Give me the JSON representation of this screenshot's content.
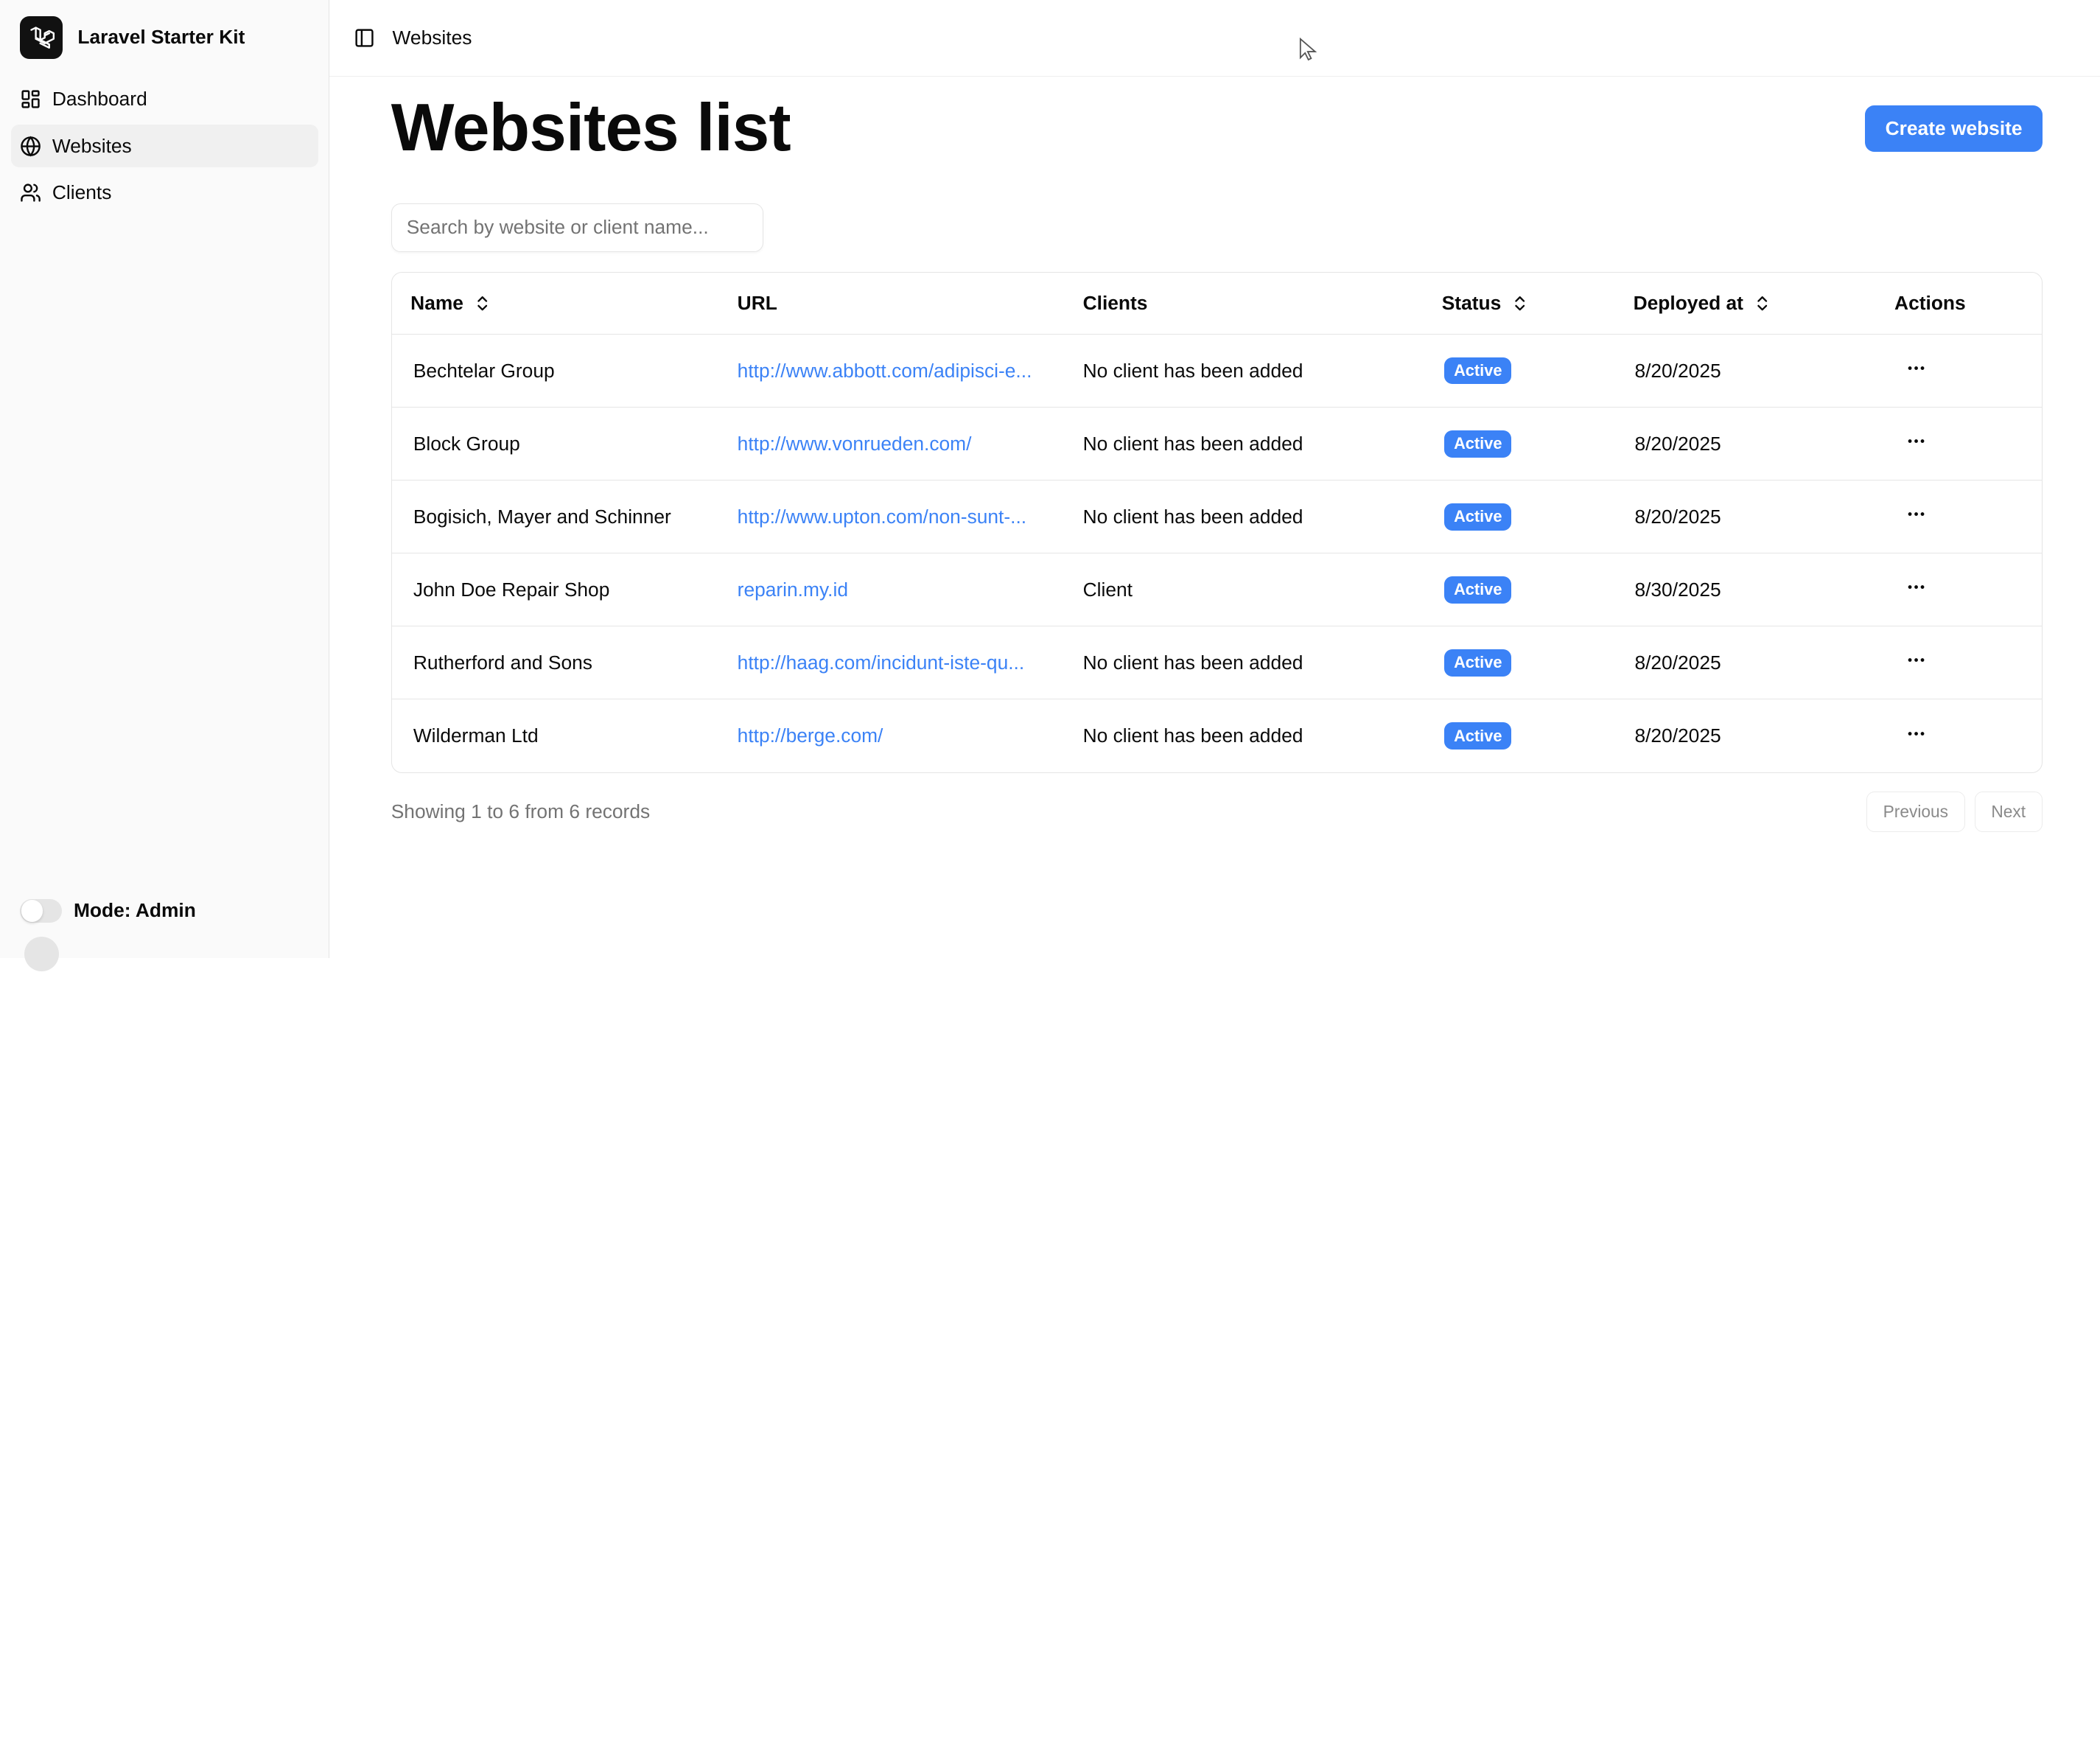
{
  "app": {
    "name": "Laravel Starter Kit"
  },
  "sidebar": {
    "items": [
      {
        "label": "Dashboard",
        "icon": "grid-icon",
        "active": false
      },
      {
        "label": "Websites",
        "icon": "globe-icon",
        "active": true
      },
      {
        "label": "Clients",
        "icon": "users-icon",
        "active": false
      }
    ],
    "mode_label": "Mode: Admin"
  },
  "topbar": {
    "breadcrumb": "Websites"
  },
  "page": {
    "title": "Websites list",
    "create_button": "Create website",
    "search_placeholder": "Search by website or client name..."
  },
  "table": {
    "columns": [
      "Name",
      "URL",
      "Clients",
      "Status",
      "Deployed at",
      "Actions"
    ],
    "rows": [
      {
        "name": "Bechtelar Group",
        "url": "http://www.abbott.com/adipisci-e...",
        "clients": "No client has been added",
        "status": "Active",
        "deployed": "8/20/2025"
      },
      {
        "name": "Block Group",
        "url": "http://www.vonrueden.com/",
        "clients": "No client has been added",
        "status": "Active",
        "deployed": "8/20/2025"
      },
      {
        "name": "Bogisich, Mayer and Schinner",
        "url": "http://www.upton.com/non-sunt-...",
        "clients": "No client has been added",
        "status": "Active",
        "deployed": "8/20/2025"
      },
      {
        "name": "John Doe Repair Shop",
        "url": "reparin.my.id",
        "clients": "Client",
        "status": "Active",
        "deployed": "8/30/2025"
      },
      {
        "name": "Rutherford and Sons",
        "url": "http://haag.com/incidunt-iste-qu...",
        "clients": "No client has been added",
        "status": "Active",
        "deployed": "8/20/2025"
      },
      {
        "name": "Wilderman Ltd",
        "url": "http://berge.com/",
        "clients": "No client has been added",
        "status": "Active",
        "deployed": "8/20/2025"
      }
    ]
  },
  "pagination": {
    "summary": "Showing 1 to 6 from 6 records",
    "previous": "Previous",
    "next": "Next"
  },
  "colors": {
    "accent": "#3b82f6",
    "sidebar_bg": "#fafafa",
    "border": "#e5e5e5"
  }
}
